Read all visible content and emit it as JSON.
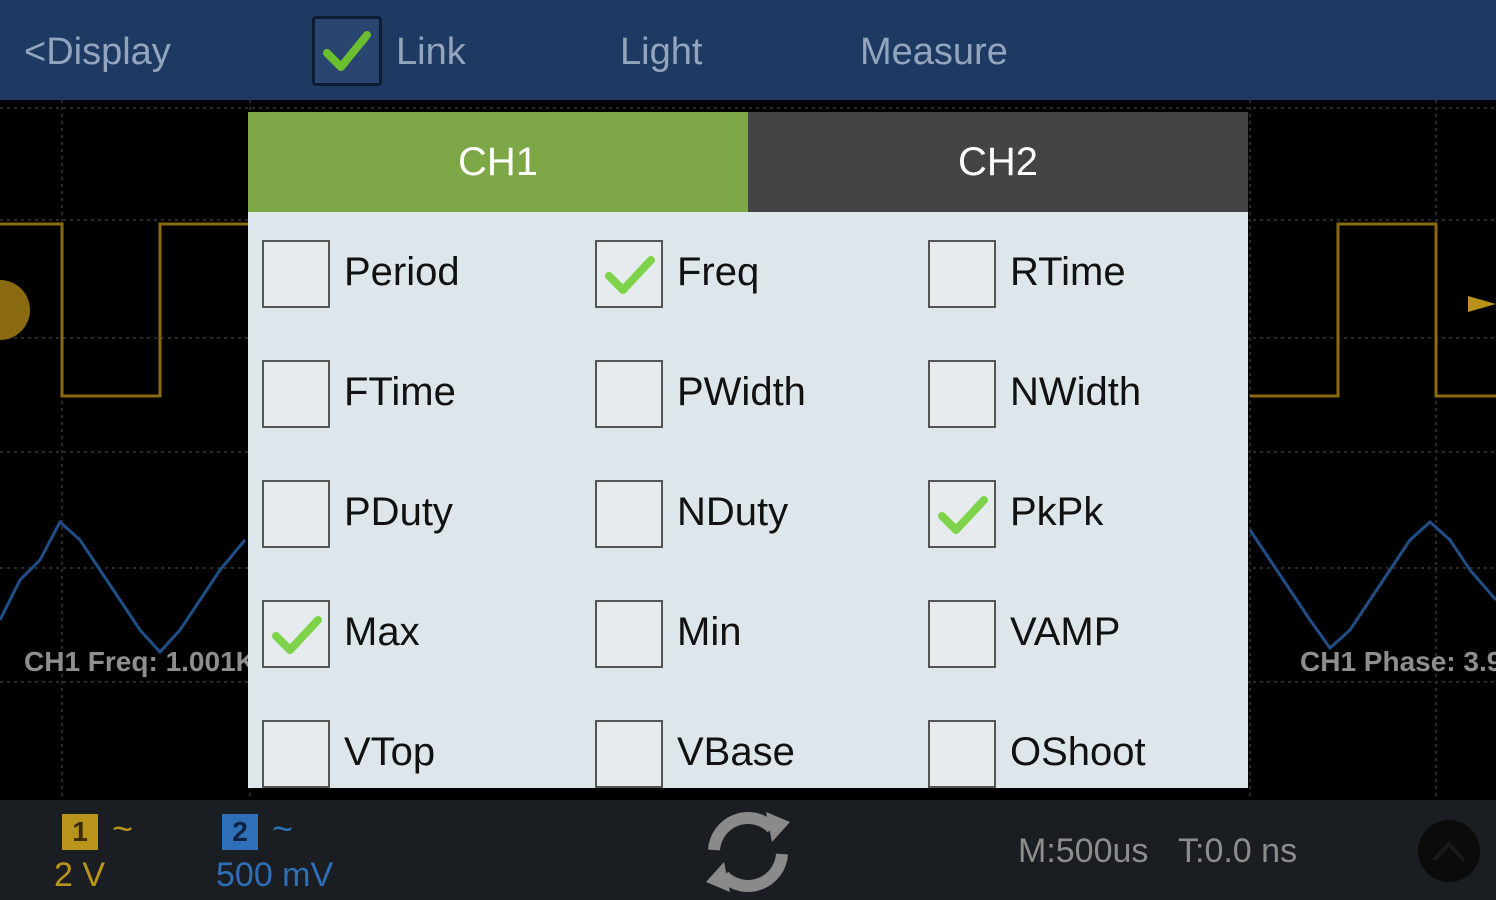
{
  "topbar": {
    "back_label": "<Display",
    "link_label": "Link",
    "link_checked": true,
    "light_label": "Light",
    "measure_label": "Measure"
  },
  "scope": {
    "ch1_freq": "CH1 Freq: 1.001K",
    "ch1_phase": "CH1 Phase: 3.9"
  },
  "dialog": {
    "tabs": [
      {
        "label": "CH1",
        "active": true
      },
      {
        "label": "CH2",
        "active": false
      }
    ],
    "options": [
      {
        "label": "Period",
        "checked": false
      },
      {
        "label": "Freq",
        "checked": true
      },
      {
        "label": "RTime",
        "checked": false
      },
      {
        "label": "FTime",
        "checked": false
      },
      {
        "label": "PWidth",
        "checked": false
      },
      {
        "label": "NWidth",
        "checked": false
      },
      {
        "label": "PDuty",
        "checked": false
      },
      {
        "label": "NDuty",
        "checked": false
      },
      {
        "label": "PkPk",
        "checked": true
      },
      {
        "label": "Max",
        "checked": true
      },
      {
        "label": "Min",
        "checked": false
      },
      {
        "label": "VAMP",
        "checked": false
      },
      {
        "label": "VTop",
        "checked": false
      },
      {
        "label": "VBase",
        "checked": false
      },
      {
        "label": "OShoot",
        "checked": false
      }
    ]
  },
  "bottombar": {
    "ch1_number": "1",
    "ch1_coupling": "~",
    "ch1_scale": "2 V",
    "ch2_number": "2",
    "ch2_coupling": "~",
    "ch2_scale": "500 mV",
    "timebase": "M:500us",
    "trigger_time": "T:0.0 ns"
  },
  "colors": {
    "ch1": "#b8941a",
    "ch2": "#2f6fb8",
    "active_tab": "#7da647",
    "check": "#7fd34a"
  },
  "icons": [
    "check-icon",
    "refresh-icon",
    "run-stop-icon",
    "trigger-marker-icon"
  ]
}
